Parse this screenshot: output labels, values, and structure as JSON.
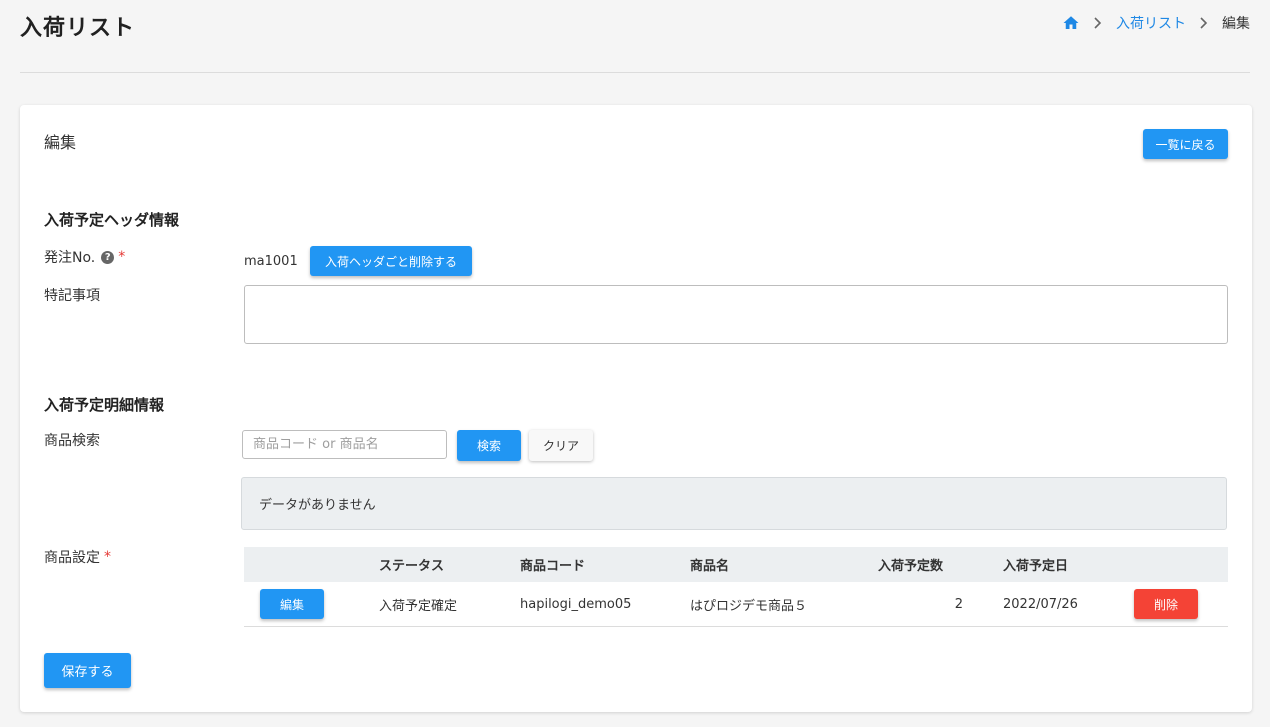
{
  "page": {
    "title": "入荷リスト",
    "breadcrumb": {
      "home_icon": "home-icon",
      "link": "入荷リスト",
      "current": "編集"
    }
  },
  "card": {
    "title": "編集",
    "back_button": "一覧に戻る",
    "header_section": {
      "title": "入荷予定ヘッダ情報",
      "order_no_label": "発注No.",
      "help_icon": "question-circle-icon",
      "order_no_value": "ma1001",
      "delete_header_button": "入荷ヘッダごと削除する",
      "notes_label": "特記事項",
      "notes_value": ""
    },
    "detail_section": {
      "title": "入荷予定明細情報",
      "search_label": "商品検索",
      "search_placeholder": "商品コード or 商品名",
      "search_button": "検索",
      "clear_button": "クリア",
      "empty_message": "データがありません",
      "product_setting_label": "商品設定"
    },
    "table": {
      "headers": [
        "",
        "ステータス",
        "商品コード",
        "商品名",
        "入荷予定数",
        "入荷予定日",
        ""
      ],
      "rows": [
        {
          "edit_button": "編集",
          "status": "入荷予定確定",
          "code": "hapilogi_demo05",
          "name": "はぴロジデモ商品５",
          "quantity": "2",
          "date": "2022/07/26",
          "delete_button": "削除"
        }
      ]
    },
    "save_button": "保存する"
  },
  "colors": {
    "primary": "#2196f3",
    "danger": "#f44336",
    "required": "#e53935"
  }
}
